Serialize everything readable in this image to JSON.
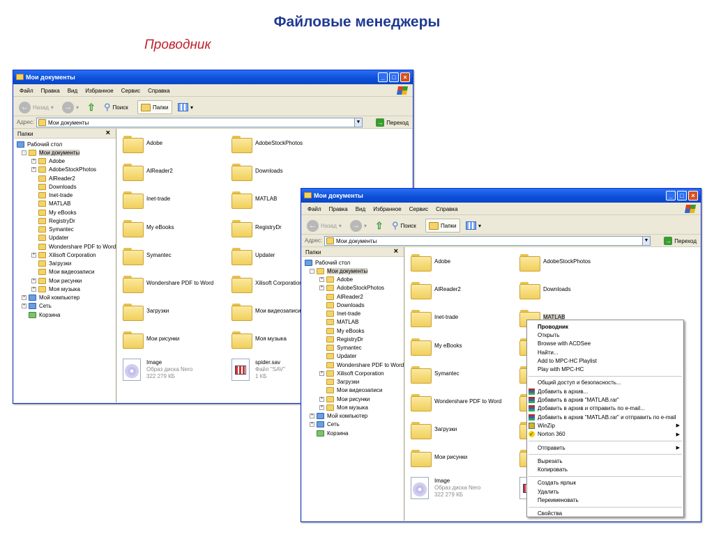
{
  "page": {
    "title": "Файловые менеджеры",
    "subtitle": "Проводник"
  },
  "explorer": {
    "window_title": "Мои документы",
    "menu": [
      "Файл",
      "Правка",
      "Вид",
      "Избранное",
      "Сервис",
      "Справка"
    ],
    "toolbar": {
      "back": "Назад",
      "search": "Поиск",
      "folders": "Папки"
    },
    "address": {
      "label": "Адрес:",
      "value": "Мои документы",
      "go": "Переход"
    },
    "folders_pane": {
      "title": "Папки",
      "close": "×"
    },
    "tree": [
      {
        "label": "Рабочий стол",
        "level": 0,
        "icon": "desktop"
      },
      {
        "label": "Мои документы",
        "level": 1,
        "exp": "-",
        "icon": "docs",
        "selected": true
      },
      {
        "label": "Adobe",
        "level": 2,
        "exp": "+"
      },
      {
        "label": "AdobeStockPhotos",
        "level": 2,
        "exp": "+"
      },
      {
        "label": "AlReader2",
        "level": 2
      },
      {
        "label": "Downloads",
        "level": 2
      },
      {
        "label": "Inet-trade",
        "level": 2
      },
      {
        "label": "MATLAB",
        "level": 2
      },
      {
        "label": "My eBooks",
        "level": 2
      },
      {
        "label": "RegistryDr",
        "level": 2
      },
      {
        "label": "Symantec",
        "level": 2
      },
      {
        "label": "Updater",
        "level": 2
      },
      {
        "label": "Wondershare PDF to Word",
        "level": 2
      },
      {
        "label": "Xilisoft Corporation",
        "level": 2,
        "exp": "+"
      },
      {
        "label": "Загрузки",
        "level": 2
      },
      {
        "label": "Мои видеозаписи",
        "level": 2
      },
      {
        "label": "Мои рисунки",
        "level": 2,
        "exp": "+"
      },
      {
        "label": "Моя музыка",
        "level": 2,
        "exp": "+"
      },
      {
        "label": "Мой компьютер",
        "level": 1,
        "exp": "+",
        "icon": "pc"
      },
      {
        "label": "Сеть",
        "level": 1,
        "exp": "+",
        "icon": "pc"
      },
      {
        "label": "Корзина",
        "level": 1,
        "icon": "bin"
      }
    ],
    "items": [
      {
        "name": "Adobe",
        "type": "folder"
      },
      {
        "name": "AdobeStockPhotos",
        "type": "folder"
      },
      {
        "name": "AlReader2",
        "type": "folder"
      },
      {
        "name": "Downloads",
        "type": "folder"
      },
      {
        "name": "Inet-trade",
        "type": "folder"
      },
      {
        "name": "MATLAB",
        "type": "folder"
      },
      {
        "name": "My eBooks",
        "type": "folder"
      },
      {
        "name": "RegistryDr",
        "type": "folder"
      },
      {
        "name": "Symantec",
        "type": "folder"
      },
      {
        "name": "Updater",
        "type": "folder"
      },
      {
        "name": "Wondershare PDF to Word",
        "type": "folder"
      },
      {
        "name": "Xilisoft Corporation",
        "type": "folder"
      },
      {
        "name": "Загрузки",
        "type": "folder"
      },
      {
        "name": "Мои видеозаписи",
        "type": "folder"
      },
      {
        "name": "Мои рисунки",
        "type": "folder"
      },
      {
        "name": "Моя музыка",
        "type": "folder"
      },
      {
        "name": "Image",
        "type": "disc",
        "kind": "Образ диска Nero",
        "size": "322 279 КБ"
      },
      {
        "name": "spider.sav",
        "type": "sav",
        "kind": "Файл \"SAV\"",
        "size": "1 КБ"
      }
    ]
  },
  "window2": {
    "selected_item": "MATLAB"
  },
  "context_menu": [
    {
      "label": "Проводник",
      "bold": true
    },
    {
      "label": "Открыть"
    },
    {
      "label": "Browse with ACDSee"
    },
    {
      "label": "Найти..."
    },
    {
      "label": "Add to MPC-HC Playlist"
    },
    {
      "label": "Play with MPC-HC"
    },
    {
      "sep": true
    },
    {
      "label": "Общий доступ и безопасность..."
    },
    {
      "label": "Добавить в архив...",
      "icon": "rar"
    },
    {
      "label": "Добавить в архив \"MATLAB.rar\"",
      "icon": "rar"
    },
    {
      "label": "Добавить в архив и отправить по e-mail...",
      "icon": "rar"
    },
    {
      "label": "Добавить в архив \"MATLAB.rar\" и отправить по e-mail",
      "icon": "rar"
    },
    {
      "label": "WinZip",
      "icon": "winzip",
      "submenu": true
    },
    {
      "label": "Norton 360",
      "icon": "norton",
      "submenu": true
    },
    {
      "sep": true
    },
    {
      "label": "Отправить",
      "submenu": true
    },
    {
      "sep": true
    },
    {
      "label": "Вырезать"
    },
    {
      "label": "Копировать"
    },
    {
      "sep": true
    },
    {
      "label": "Создать ярлык"
    },
    {
      "label": "Удалить"
    },
    {
      "label": "Переименовать"
    },
    {
      "sep": true
    },
    {
      "label": "Свойства"
    }
  ]
}
